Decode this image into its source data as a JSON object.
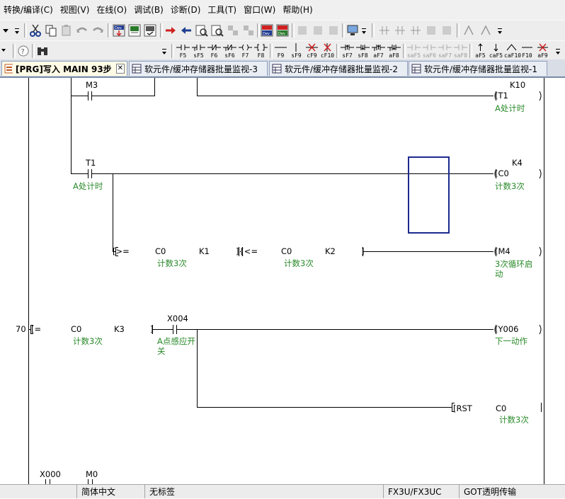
{
  "menus": [
    "转换/编译(C)",
    "视图(V)",
    "在线(O)",
    "调试(B)",
    "诊断(D)",
    "工具(T)",
    "窗口(W)",
    "帮助(H)"
  ],
  "fkeys": [
    "F5",
    "sF5",
    "F6",
    "sF6",
    "F7",
    "F8",
    "F9",
    "sF9",
    "cF9",
    "cF10",
    "sF7",
    "sF8",
    "aF7",
    "aF8",
    "saF5",
    "saF6",
    "saF7",
    "saF8",
    "aF5",
    "caF5",
    "caF10",
    "F10",
    "aF9"
  ],
  "tabs": [
    {
      "label": "[PRG]写入 MAIN 93步",
      "active": true
    },
    {
      "label": "软元件/缓冲存储器批量监视-3",
      "active": false
    },
    {
      "label": "软元件/缓冲存储器批量监视-2",
      "active": false
    },
    {
      "label": "软元件/缓冲存储器批量监视-1",
      "active": false
    }
  ],
  "ladder": {
    "rung1": {
      "contact": "M3",
      "coil": "(T1",
      "coil_value": "K10",
      "coil_comment": "A处计时"
    },
    "rung2": {
      "contact": "T1",
      "contact_comment": "A处计时",
      "coil": "(C0",
      "coil_value": "K4",
      "coil_comment": "计数3次"
    },
    "rung3": {
      "cmp1_op": "[>=",
      "cmp1_dev": "C0",
      "cmp1_dev_comment": "计数3次",
      "cmp1_val": "K1",
      "cmp2_op": "]{<=",
      "cmp2_dev": "C0",
      "cmp2_dev_comment": "计数3次",
      "cmp2_val": "K2",
      "cmp2_close": "]",
      "coil": "(M4",
      "coil_comment": "3次循环启动"
    },
    "rung4": {
      "step": "70",
      "cmp_op": "[=",
      "cmp_dev": "C0",
      "cmp_dev_comment": "计数3次",
      "cmp_val": "K3",
      "cmp_close": "]",
      "contact": "X004",
      "contact_comment": "A点感应开关",
      "coil": "(Y006",
      "coil_comment": "下一动作",
      "rst_op": "[RST",
      "rst_dev": "C0",
      "rst_dev_comment": "计数3次"
    },
    "rung5": {
      "contact1": "X000",
      "contact2": "M0"
    }
  },
  "status": {
    "lang": "简体中文",
    "title": "无标签",
    "cpu": "FX3U/FX3UC",
    "got": "GOT透明传输"
  },
  "colors": {
    "cursor": "#1c2a8f",
    "comment": "#2a8a2a",
    "rail": "#000000"
  }
}
